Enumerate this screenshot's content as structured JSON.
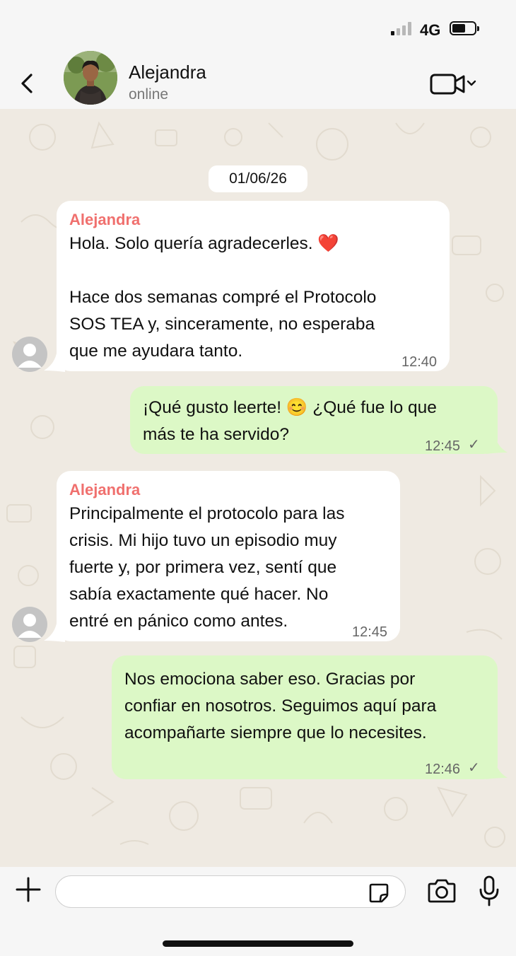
{
  "status_bar": {
    "network": "4G"
  },
  "header": {
    "contact_name": "Alejandra",
    "contact_status": "online"
  },
  "chat": {
    "date": "01/06/26",
    "messages": [
      {
        "direction": "incoming",
        "sender": "Alejandra",
        "lines": [
          "Hola. Solo quería agradecerles. ❤️",
          "",
          "Hace dos semanas compré el Protocolo",
          "SOS TEA y, sinceramente, no esperaba",
          "que me ayudara tanto."
        ],
        "time": "12:40"
      },
      {
        "direction": "outgoing",
        "lines": [
          "¡Qué gusto leerte! 😊 ¿Qué fue lo que",
          "más te ha servido?"
        ],
        "time": "12:45",
        "tick": "✓"
      },
      {
        "direction": "incoming",
        "sender": "Alejandra",
        "lines": [
          "Principalmente el protocolo para las",
          "crisis. Mi hijo tuvo un episodio muy",
          "fuerte y, por primera vez, sentí que",
          "sabía exactamente qué hacer. No",
          "entré en pánico como antes."
        ],
        "time": "12:45"
      },
      {
        "direction": "outgoing",
        "lines": [
          "Nos emociona saber eso. Gracias por",
          "confiar en nosotros. Seguimos aquí para",
          "acompañarte siempre que lo necesites."
        ],
        "time": "12:46",
        "tick": "✓"
      }
    ]
  },
  "composer": {
    "value": "",
    "placeholder": ""
  },
  "icons": {
    "back": "chevron-left-icon",
    "video": "video-camera-icon",
    "plus": "plus-icon",
    "sticker": "sticker-icon",
    "camera": "camera-icon",
    "mic": "microphone-icon"
  },
  "colors": {
    "incoming_bubble": "#ffffff",
    "outgoing_bubble": "#dcf8c6",
    "sender_name": "#f0706e",
    "chat_background": "#efeae2"
  }
}
